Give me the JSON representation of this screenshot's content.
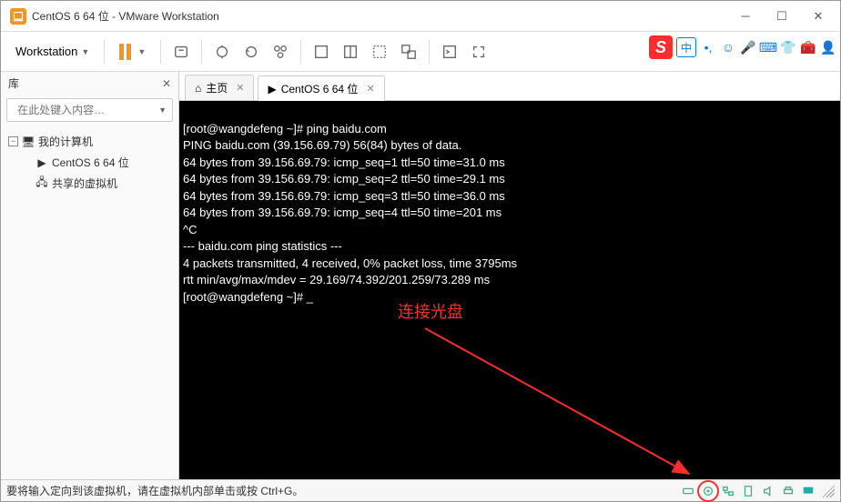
{
  "window": {
    "title": "CentOS 6 64 位 - VMware Workstation"
  },
  "menu": {
    "workstation": "Workstation"
  },
  "sidebar": {
    "header": "库",
    "search_placeholder": "在此处键入内容…",
    "root": "我的计算机",
    "vm": "CentOS 6 64 位",
    "shared": "共享的虚拟机"
  },
  "tabs": {
    "home": "主页",
    "vm": "CentOS 6 64 位"
  },
  "terminal": {
    "lines": [
      "[root@wangdefeng ~]# ping baidu.com",
      "PING baidu.com (39.156.69.79) 56(84) bytes of data.",
      "64 bytes from 39.156.69.79: icmp_seq=1 ttl=50 time=31.0 ms",
      "64 bytes from 39.156.69.79: icmp_seq=2 ttl=50 time=29.1 ms",
      "64 bytes from 39.156.69.79: icmp_seq=3 ttl=50 time=36.0 ms",
      "64 bytes from 39.156.69.79: icmp_seq=4 ttl=50 time=201 ms",
      "^C",
      "--- baidu.com ping statistics ---",
      "4 packets transmitted, 4 received, 0% packet loss, time 3795ms",
      "rtt min/avg/max/mdev = 29.169/74.392/201.259/73.289 ms",
      "[root@wangdefeng ~]# _"
    ]
  },
  "annotation": {
    "label": "连接光盘"
  },
  "status": {
    "hint": "要将输入定向到该虚拟机，请在虚拟机内部单击或按 Ctrl+G。"
  },
  "ime": {
    "logo": "S",
    "lang": "中"
  }
}
